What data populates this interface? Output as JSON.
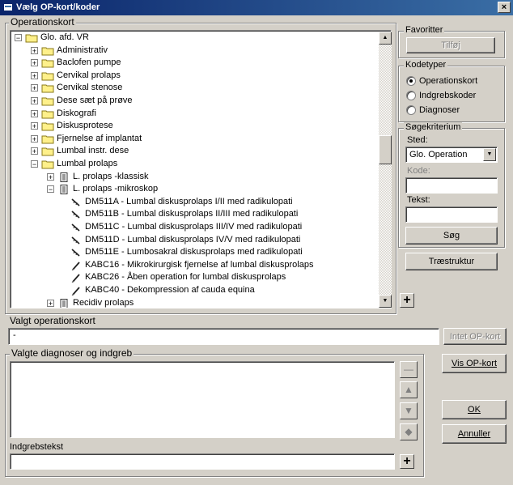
{
  "window": {
    "title": "Vælg OP-kort/koder",
    "close_label": "×"
  },
  "operationskort": {
    "group_label": "Operationskort",
    "tree": [
      {
        "label": "Glo. afd. VR",
        "expander": "−",
        "icon": "open-folder-icon"
      },
      {
        "label": "Administrativ",
        "expander": "+",
        "icon": "folder-icon"
      },
      {
        "label": "Baclofen pumpe",
        "expander": "+",
        "icon": "folder-icon"
      },
      {
        "label": "Cervikal prolaps",
        "expander": "+",
        "icon": "folder-icon"
      },
      {
        "label": "Cervikal stenose",
        "expander": "+",
        "icon": "folder-icon"
      },
      {
        "label": "Dese sæt på prøve",
        "expander": "+",
        "icon": "folder-icon"
      },
      {
        "label": "Diskografi",
        "expander": "+",
        "icon": "folder-icon"
      },
      {
        "label": "Diskusprotese",
        "expander": "+",
        "icon": "folder-icon"
      },
      {
        "label": "Fjernelse af implantat",
        "expander": "+",
        "icon": "folder-icon"
      },
      {
        "label": "Lumbal instr. dese",
        "expander": "+",
        "icon": "folder-icon"
      },
      {
        "label": "Lumbal prolaps",
        "expander": "−",
        "icon": "open-folder-icon"
      },
      {
        "label": "L. prolaps -klassisk",
        "expander": "+",
        "icon": "document-icon"
      },
      {
        "label": "L. prolaps -mikroskop",
        "expander": "−",
        "icon": "document-icon"
      },
      {
        "label": "DM511A - Lumbal diskusprolaps I/II med radikulopati",
        "expander": "",
        "icon": "diagnosis-icon"
      },
      {
        "label": "DM511B - Lumbal diskusprolaps II/III med radikulopati",
        "expander": "",
        "icon": "diagnosis-icon"
      },
      {
        "label": "DM511C - Lumbal diskusprolaps III/IV med radikulopati",
        "expander": "",
        "icon": "diagnosis-icon"
      },
      {
        "label": "DM511D - Lumbal diskusprolaps IV/V med radikulopati",
        "expander": "",
        "icon": "diagnosis-icon"
      },
      {
        "label": "DM511E - Lumbosakral diskusprolaps med radikulopati",
        "expander": "",
        "icon": "diagnosis-icon"
      },
      {
        "label": "KABC16 - Mikrokirurgisk fjernelse af lumbal diskusprolaps",
        "expander": "",
        "icon": "procedure-icon"
      },
      {
        "label": "KABC26 - Åben operation for lumbal diskusprolaps",
        "expander": "",
        "icon": "procedure-icon"
      },
      {
        "label": "KABC40 - Dekompression af cauda equina",
        "expander": "",
        "icon": "procedure-icon"
      },
      {
        "label": "Recidiv prolaps",
        "expander": "+",
        "icon": "document-icon"
      }
    ],
    "add_label": "+"
  },
  "favoritter": {
    "group_label": "Favoritter",
    "button": "Tilføj"
  },
  "kodetyper": {
    "group_label": "Kodetyper",
    "options": [
      "Operationskort",
      "Indgrebskoder",
      "Diagnoser"
    ],
    "selected": "Operationskort"
  },
  "soegekriterium": {
    "group_label": "Søgekriterium",
    "sted_label": "Sted:",
    "sted_value": "Glo. Operation",
    "kode_label": "Kode:",
    "kode_value": "",
    "tekst_label": "Tekst:",
    "tekst_value": "",
    "search_button": "Søg"
  },
  "traestruktur_button": "Træstruktur",
  "valgt": {
    "label": "Valgt operationskort",
    "value": "-",
    "button": "Intet OP-kort"
  },
  "valgte": {
    "group_label": "Valgte diagnoser og indgreb",
    "side_buttons": [
      "—",
      "▲",
      "▼",
      "◆"
    ],
    "indgrebstekst_label": "Indgrebstekst",
    "indgrebstekst_value": "",
    "add_label": "+"
  },
  "buttons": {
    "vis_op_kort": "Vis OP-kort",
    "ok": "OK",
    "annuller": "Annuller"
  }
}
